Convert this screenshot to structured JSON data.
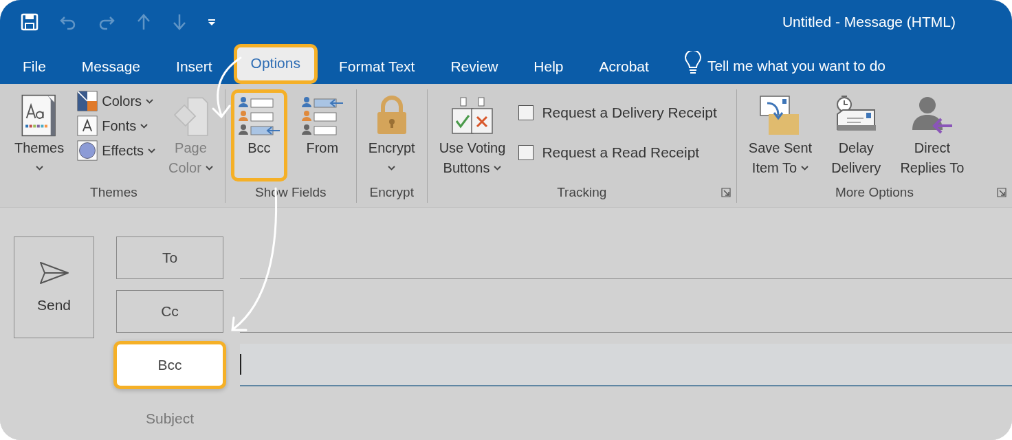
{
  "window": {
    "title": "Untitled - Message (HTML)"
  },
  "quick_access": [
    {
      "kind": "save",
      "disabled": false
    },
    {
      "kind": "undo",
      "disabled": true
    },
    {
      "kind": "redo",
      "disabled": true
    },
    {
      "kind": "up",
      "disabled": true
    },
    {
      "kind": "down",
      "disabled": true
    },
    {
      "kind": "customize",
      "disabled": false
    }
  ],
  "tabs": [
    {
      "label": "File",
      "selected": false,
      "highlighted": false
    },
    {
      "label": "Message",
      "selected": false,
      "highlighted": false
    },
    {
      "label": "Insert",
      "selected": false,
      "highlighted": false
    },
    {
      "label": "Options",
      "selected": true,
      "highlighted": true
    },
    {
      "label": "Format Text",
      "selected": false,
      "highlighted": false
    },
    {
      "label": "Review",
      "selected": false,
      "highlighted": false
    },
    {
      "label": "Help",
      "selected": false,
      "highlighted": false
    },
    {
      "label": "Acrobat",
      "selected": false,
      "highlighted": false
    }
  ],
  "tell_me": {
    "placeholder": "Tell me what you want to do"
  },
  "ribbon": {
    "groups": [
      {
        "label": "Themes",
        "items": [
          {
            "kind": "large",
            "lines": [
              "Themes"
            ],
            "dropdown": true,
            "disabled": false,
            "highlighted": false
          },
          {
            "kind": "stack",
            "items": [
              {
                "label": "Colors",
                "dropdown": true
              },
              {
                "label": "Fonts",
                "dropdown": true
              },
              {
                "label": "Effects",
                "dropdown": true
              }
            ]
          },
          {
            "kind": "large",
            "lines": [
              "Page",
              "Color"
            ],
            "dropdown": true,
            "disabled": true,
            "highlighted": false
          }
        ]
      },
      {
        "label": "Show Fields",
        "items": [
          {
            "kind": "large",
            "lines": [
              "Bcc"
            ],
            "dropdown": false,
            "disabled": false,
            "highlighted": true
          },
          {
            "kind": "large",
            "lines": [
              "From"
            ],
            "dropdown": false,
            "disabled": false,
            "highlighted": false
          }
        ]
      },
      {
        "label": "Encrypt",
        "items": [
          {
            "kind": "large",
            "lines": [
              "Encrypt"
            ],
            "dropdown": true,
            "disabled": false,
            "highlighted": false
          }
        ]
      },
      {
        "label": "Tracking",
        "launcher": true,
        "items": [
          {
            "kind": "large",
            "lines": [
              "Use Voting",
              "Buttons"
            ],
            "dropdown": true,
            "disabled": false,
            "highlighted": false
          },
          {
            "kind": "checks",
            "items": [
              {
                "label": "Request a Delivery Receipt",
                "checked": false
              },
              {
                "label": "Request a Read Receipt",
                "checked": false
              }
            ]
          }
        ]
      },
      {
        "label": "More Options",
        "launcher": true,
        "items": [
          {
            "kind": "large",
            "lines": [
              "Save Sent",
              "Item To"
            ],
            "dropdown": true,
            "disabled": false,
            "highlighted": false
          },
          {
            "kind": "large",
            "lines": [
              "Delay",
              "Delivery"
            ],
            "dropdown": false,
            "disabled": false,
            "highlighted": false
          },
          {
            "kind": "large",
            "lines": [
              "Direct",
              "Replies To"
            ],
            "dropdown": false,
            "disabled": false,
            "highlighted": false
          }
        ]
      }
    ]
  },
  "compose": {
    "send": {
      "label": "Send"
    },
    "fields": [
      {
        "kind": "button",
        "label": "To",
        "highlighted": false,
        "focused": false
      },
      {
        "kind": "button",
        "label": "Cc",
        "highlighted": false,
        "focused": false
      },
      {
        "kind": "button",
        "label": "Bcc",
        "highlighted": true,
        "focused": true
      },
      {
        "kind": "plain",
        "label": "Subject",
        "highlighted": false
      }
    ]
  }
}
